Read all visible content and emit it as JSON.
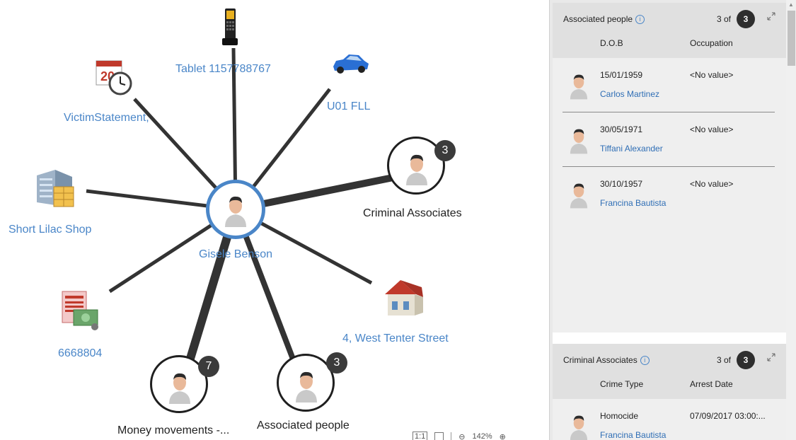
{
  "graph": {
    "center": {
      "label": "Gisele Benson"
    },
    "nodes": {
      "tablet": "Tablet 1157788767",
      "car": "U01 FLL",
      "statement": "VictimStatement,",
      "shop": "Short Lilac Shop",
      "criminal": "Criminal Associates",
      "criminal_count": "3",
      "account": "6668804",
      "money": "Money movements -...",
      "money_count": "7",
      "associated": "Associated people",
      "associated_count": "3",
      "address": "4, West Tenter Street"
    },
    "toolbar": {
      "fit_label": "1:1",
      "zoom_level": "142%"
    }
  },
  "panel": {
    "associated": {
      "title": "Associated people",
      "count_prefix": "3 of",
      "count": "3",
      "columns": [
        "D.O.B",
        "Occupation"
      ],
      "rows": [
        {
          "dob": "15/01/1959",
          "occupation": "<No value>",
          "name": "Carlos Martinez"
        },
        {
          "dob": "30/05/1971",
          "occupation": "<No value>",
          "name": "Tiffani Alexander"
        },
        {
          "dob": "30/10/1957",
          "occupation": "<No value>",
          "name": "Francina Bautista"
        }
      ]
    },
    "criminal": {
      "title": "Criminal Associates",
      "count_prefix": "3 of",
      "count": "3",
      "columns": [
        "Crime Type",
        "Arrest Date"
      ],
      "rows": [
        {
          "crime": "Homocide",
          "date": "07/09/2017 03:00:...",
          "name": "Francina Bautista"
        }
      ]
    }
  },
  "colors": {
    "accent": "#4a86c8",
    "link": "#2f6eb5",
    "badge": "#3b3b3b"
  }
}
